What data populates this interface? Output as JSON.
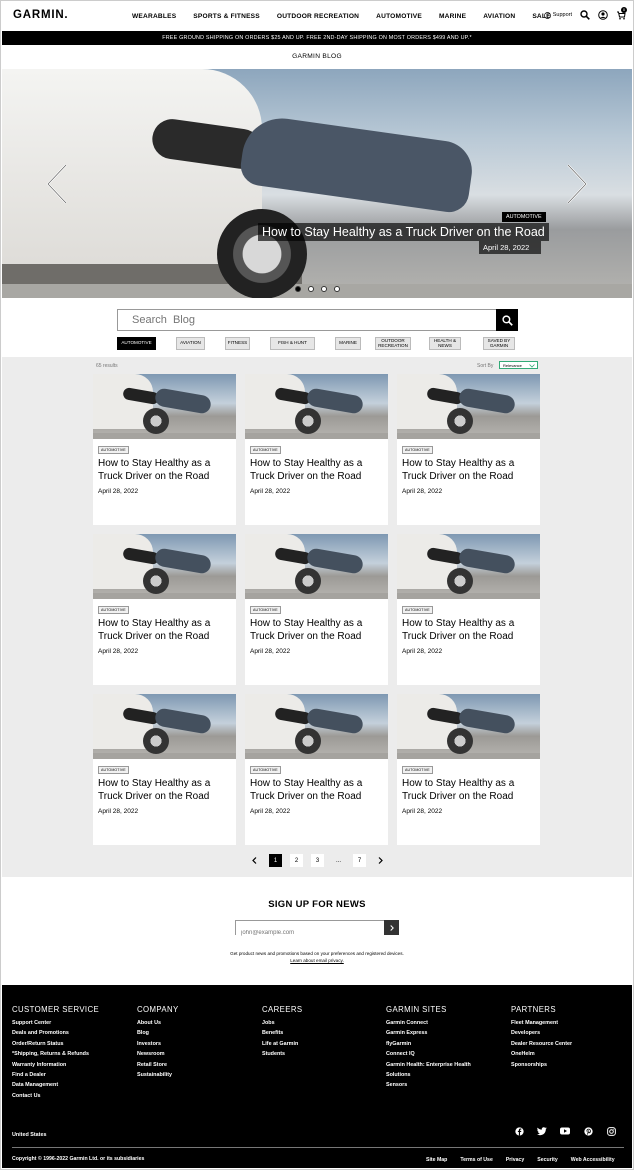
{
  "header": {
    "logo": "GARMIN.",
    "nav": [
      "WEARABLES",
      "SPORTS & FITNESS",
      "OUTDOOR RECREATION",
      "AUTOMOTIVE",
      "MARINE",
      "AVIATION",
      "SALE"
    ],
    "support_label": "Support",
    "cart_count": "0"
  },
  "promo": "FREE GROUND SHIPPING ON ORDERS $25 AND UP. FREE 2ND-DAY SHIPPING ON MOST ORDERS $499 AND UP.*",
  "blog_title": "GARMIN BLOG",
  "hero": {
    "tag": "AUTOMOTIVE",
    "title": "How to Stay Healthy as a Truck Driver on the Road",
    "date": "April 28, 2022",
    "slides": 4,
    "active_slide": 1
  },
  "search": {
    "placeholder": "Search  Blog"
  },
  "chips": [
    "AUTOMOTIVE",
    "AVIATION",
    "FITNESS",
    "FISH & HUNT",
    "MARINE",
    "OUTDOOR RECREATION",
    "HEALTH & NEWS",
    "SAVED BY GARMIN"
  ],
  "results": {
    "count_label": "65 results",
    "sort_label": "Sort By",
    "sort_value": "Relevance"
  },
  "cards": [
    {
      "tag": "AUTOMOTIVE",
      "title": "How to Stay Healthy as a Truck Driver on the Road",
      "date": "April 28, 2022"
    },
    {
      "tag": "AUTOMOTIVE",
      "title": "How to Stay Healthy as a Truck Driver on the Road",
      "date": "April 28, 2022"
    },
    {
      "tag": "AUTOMOTIVE",
      "title": "How to Stay Healthy as a Truck Driver on the Road",
      "date": "April 28, 2022"
    },
    {
      "tag": "AUTOMOTIVE",
      "title": "How to Stay Healthy as a Truck Driver on the Road",
      "date": "April 28, 2022"
    },
    {
      "tag": "AUTOMOTIVE",
      "title": "How to Stay Healthy as a Truck Driver on the Road",
      "date": "April 28, 2022"
    },
    {
      "tag": "AUTOMOTIVE",
      "title": "How to Stay Healthy as a Truck Driver on the Road",
      "date": "April 28, 2022"
    },
    {
      "tag": "AUTOMOTIVE",
      "title": "How to Stay Healthy as a Truck Driver on the Road",
      "date": "April 28, 2022"
    },
    {
      "tag": "AUTOMOTIVE",
      "title": "How to Stay Healthy as a Truck Driver on the Road",
      "date": "April 28, 2022"
    },
    {
      "tag": "AUTOMOTIVE",
      "title": "How to Stay Healthy as a Truck Driver on the Road",
      "date": "April 28, 2022"
    }
  ],
  "pagination": {
    "pages": [
      "1",
      "2",
      "3",
      "...",
      "7"
    ],
    "current": "1"
  },
  "signup": {
    "title": "SIGN UP FOR NEWS",
    "placeholder": "john@example.com",
    "note": "Get product news and promotions based on your preferences and registered devices.",
    "link": "Learn about email privacy."
  },
  "footer": {
    "columns": [
      {
        "title": "CUSTOMER SERVICE",
        "items": [
          "Support Center",
          "Deals and Promotions",
          "Order/Return Status",
          "*Shipping, Returns & Refunds",
          "Warranty Information",
          "Find a Dealer",
          "Data Management",
          "Contact Us"
        ]
      },
      {
        "title": "COMPANY",
        "items": [
          "About Us",
          "Blog",
          "Investors",
          "Newsroom",
          "Retail Store",
          "Sustainability"
        ]
      },
      {
        "title": "CAREERS",
        "items": [
          "Jobs",
          "Benefits",
          "Life at Garmin",
          "Students"
        ]
      },
      {
        "title": "GARMIN SITES",
        "items": [
          "Garmin Connect",
          "Garmin Express",
          "flyGarmin",
          "Connect IQ",
          "Garmin Health: Enterprise Health",
          "Solutions",
          "Sensors"
        ]
      },
      {
        "title": "PARTNERS",
        "items": [
          "Fleet Management",
          "Developers",
          "Dealer Resource Center",
          "OneHelm",
          "Sponsorships"
        ]
      }
    ],
    "country": "United States",
    "social": [
      "facebook-icon",
      "twitter-icon",
      "youtube-icon",
      "pinterest-icon",
      "instagram-icon"
    ],
    "copyright": "Copyright © 1996-2022 Garmin Ltd. or its subsidiaries",
    "links": [
      "Site Map",
      "Terms of Use",
      "Privacy",
      "Security",
      "Web Accessibility"
    ]
  }
}
